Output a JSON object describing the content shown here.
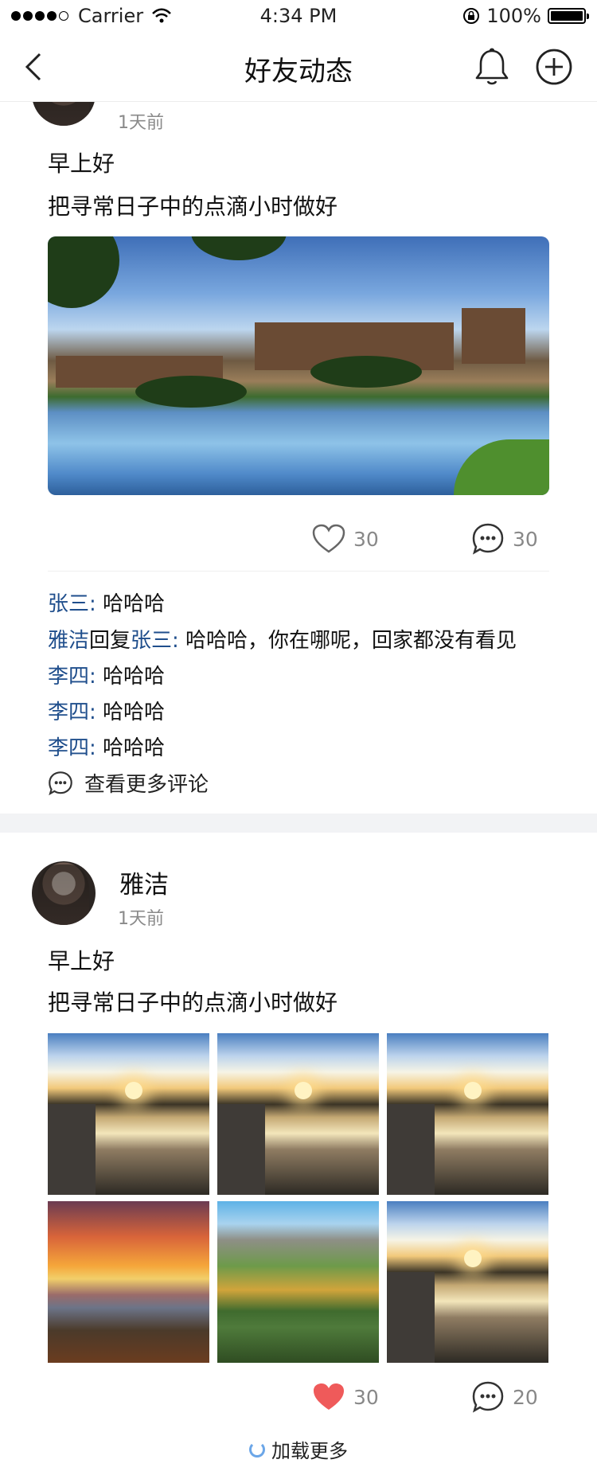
{
  "status": {
    "carrier": "Carrier",
    "time": "4:34 PM",
    "battery": "100%"
  },
  "nav": {
    "title": "好友动态",
    "back_icon": "chevron-left-icon",
    "bell_icon": "bell-icon",
    "add_icon": "plus-circle-icon"
  },
  "posts": [
    {
      "time_ago": "1天前",
      "lines": [
        "早上好",
        "把寻常日子中的点滴小时做好"
      ],
      "likes": "30",
      "comments_count": "30",
      "comments": [
        {
          "user": "张三:",
          "text": " 哈哈哈"
        },
        {
          "user": "雅洁",
          "reply_word": "回复",
          "reply_to": "张三:",
          "text": " 哈哈哈，你在哪呢，回家都没有看见"
        },
        {
          "user": "李四:",
          "text": " 哈哈哈"
        },
        {
          "user": "李四:",
          "text": " 哈哈哈"
        },
        {
          "user": "李四:",
          "text": " 哈哈哈"
        }
      ],
      "more_comments": "查看更多评论"
    },
    {
      "name": "雅洁",
      "time_ago": "1天前",
      "lines": [
        "早上好",
        "把寻常日子中的点滴小时做好"
      ],
      "likes": "30",
      "comments_count": "20",
      "liked": true
    }
  ],
  "load_more": "加载更多",
  "colors": {
    "link": "#1f4e8c",
    "like_active": "#ef5a5a",
    "muted": "#888888",
    "section_gap": "#f2f3f5"
  }
}
